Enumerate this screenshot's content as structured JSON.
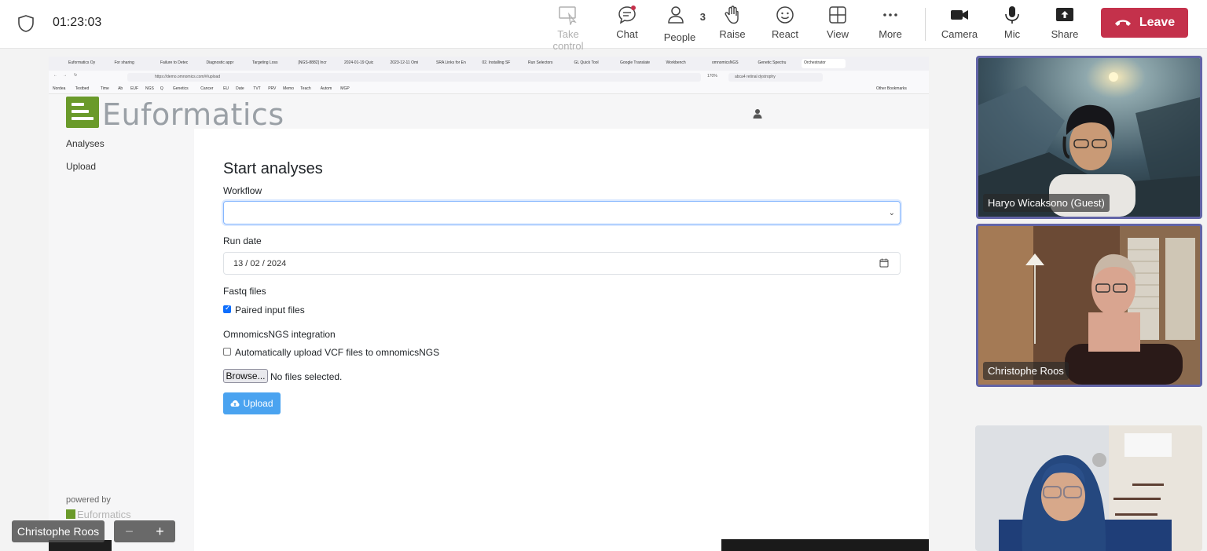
{
  "meeting": {
    "timer": "01:23:03",
    "toolbar": [
      {
        "label": "Take control",
        "icon": "take-control-icon",
        "disabled": true
      },
      {
        "label": "Chat",
        "icon": "chat-icon"
      },
      {
        "label": "People",
        "icon": "people-icon",
        "count": "3"
      },
      {
        "label": "Raise",
        "icon": "raise-hand-icon"
      },
      {
        "label": "React",
        "icon": "react-icon"
      },
      {
        "label": "View",
        "icon": "view-icon"
      },
      {
        "label": "More",
        "icon": "more-icon"
      },
      {
        "label": "Camera",
        "icon": "camera-icon"
      },
      {
        "label": "Mic",
        "icon": "mic-icon"
      },
      {
        "label": "Share",
        "icon": "share-icon"
      }
    ],
    "leave_label": "Leave",
    "leave_color": "#c4314b",
    "presenter_name": "Christophe Roos",
    "participants": [
      {
        "name": "Haryo Wicaksono (Guest)"
      },
      {
        "name": "Christophe Roos"
      },
      {
        "name": ""
      }
    ],
    "accent": "#6264a7"
  },
  "browser": {
    "tabs": [
      "Euformatics Oy",
      "For sharing",
      "Failure to Detec",
      "Diagnostic appr",
      "Targeting Loss",
      "[NGS-8882] Incr",
      "2024-01-19 Quic",
      "2023-12-11 Omi",
      "SRA Links for En",
      "02. Installing SF",
      "Run Selectors",
      "GL Quick Tool",
      "Google Translate",
      "Workbench",
      "omnomicsNGS",
      "Genetic Spectru",
      "Orchestrator"
    ],
    "url": "https://demo.omnomics.com/#/upload",
    "zoom": "170%",
    "search": "abca4 retinal dystrophy",
    "bookmarks": [
      "Nordea",
      "Testbed",
      "Time",
      "Ab",
      "EUF",
      "NGS",
      "Q",
      "Genetics",
      "Cancer",
      "EU",
      "Date",
      "TVT",
      "PRV",
      "Memo",
      "Teach",
      "Autom",
      "MGP"
    ],
    "other_bookmarks": "Other Bookmarks"
  },
  "app": {
    "brand": "Euformatics",
    "brand_color": "#6a9a2a",
    "nav": [
      "Analyses",
      "Upload"
    ],
    "powered_by": "powered by",
    "powered_brand": "Euformatics",
    "page_title": "Start analyses",
    "workflow_label": "Workflow",
    "workflow_value": "",
    "run_date_label": "Run date",
    "run_date_value": "13 / 02 / 2024",
    "fastq_label": "Fastq files",
    "paired_label": "Paired input files",
    "paired_checked": true,
    "integration_label": "OmnomicsNGS integration",
    "auto_upload_label": "Automatically upload VCF files to omnomicsNGS",
    "auto_upload_checked": false,
    "browse_label": "Browse...",
    "no_files": "No files selected.",
    "upload_label": "Upload"
  }
}
